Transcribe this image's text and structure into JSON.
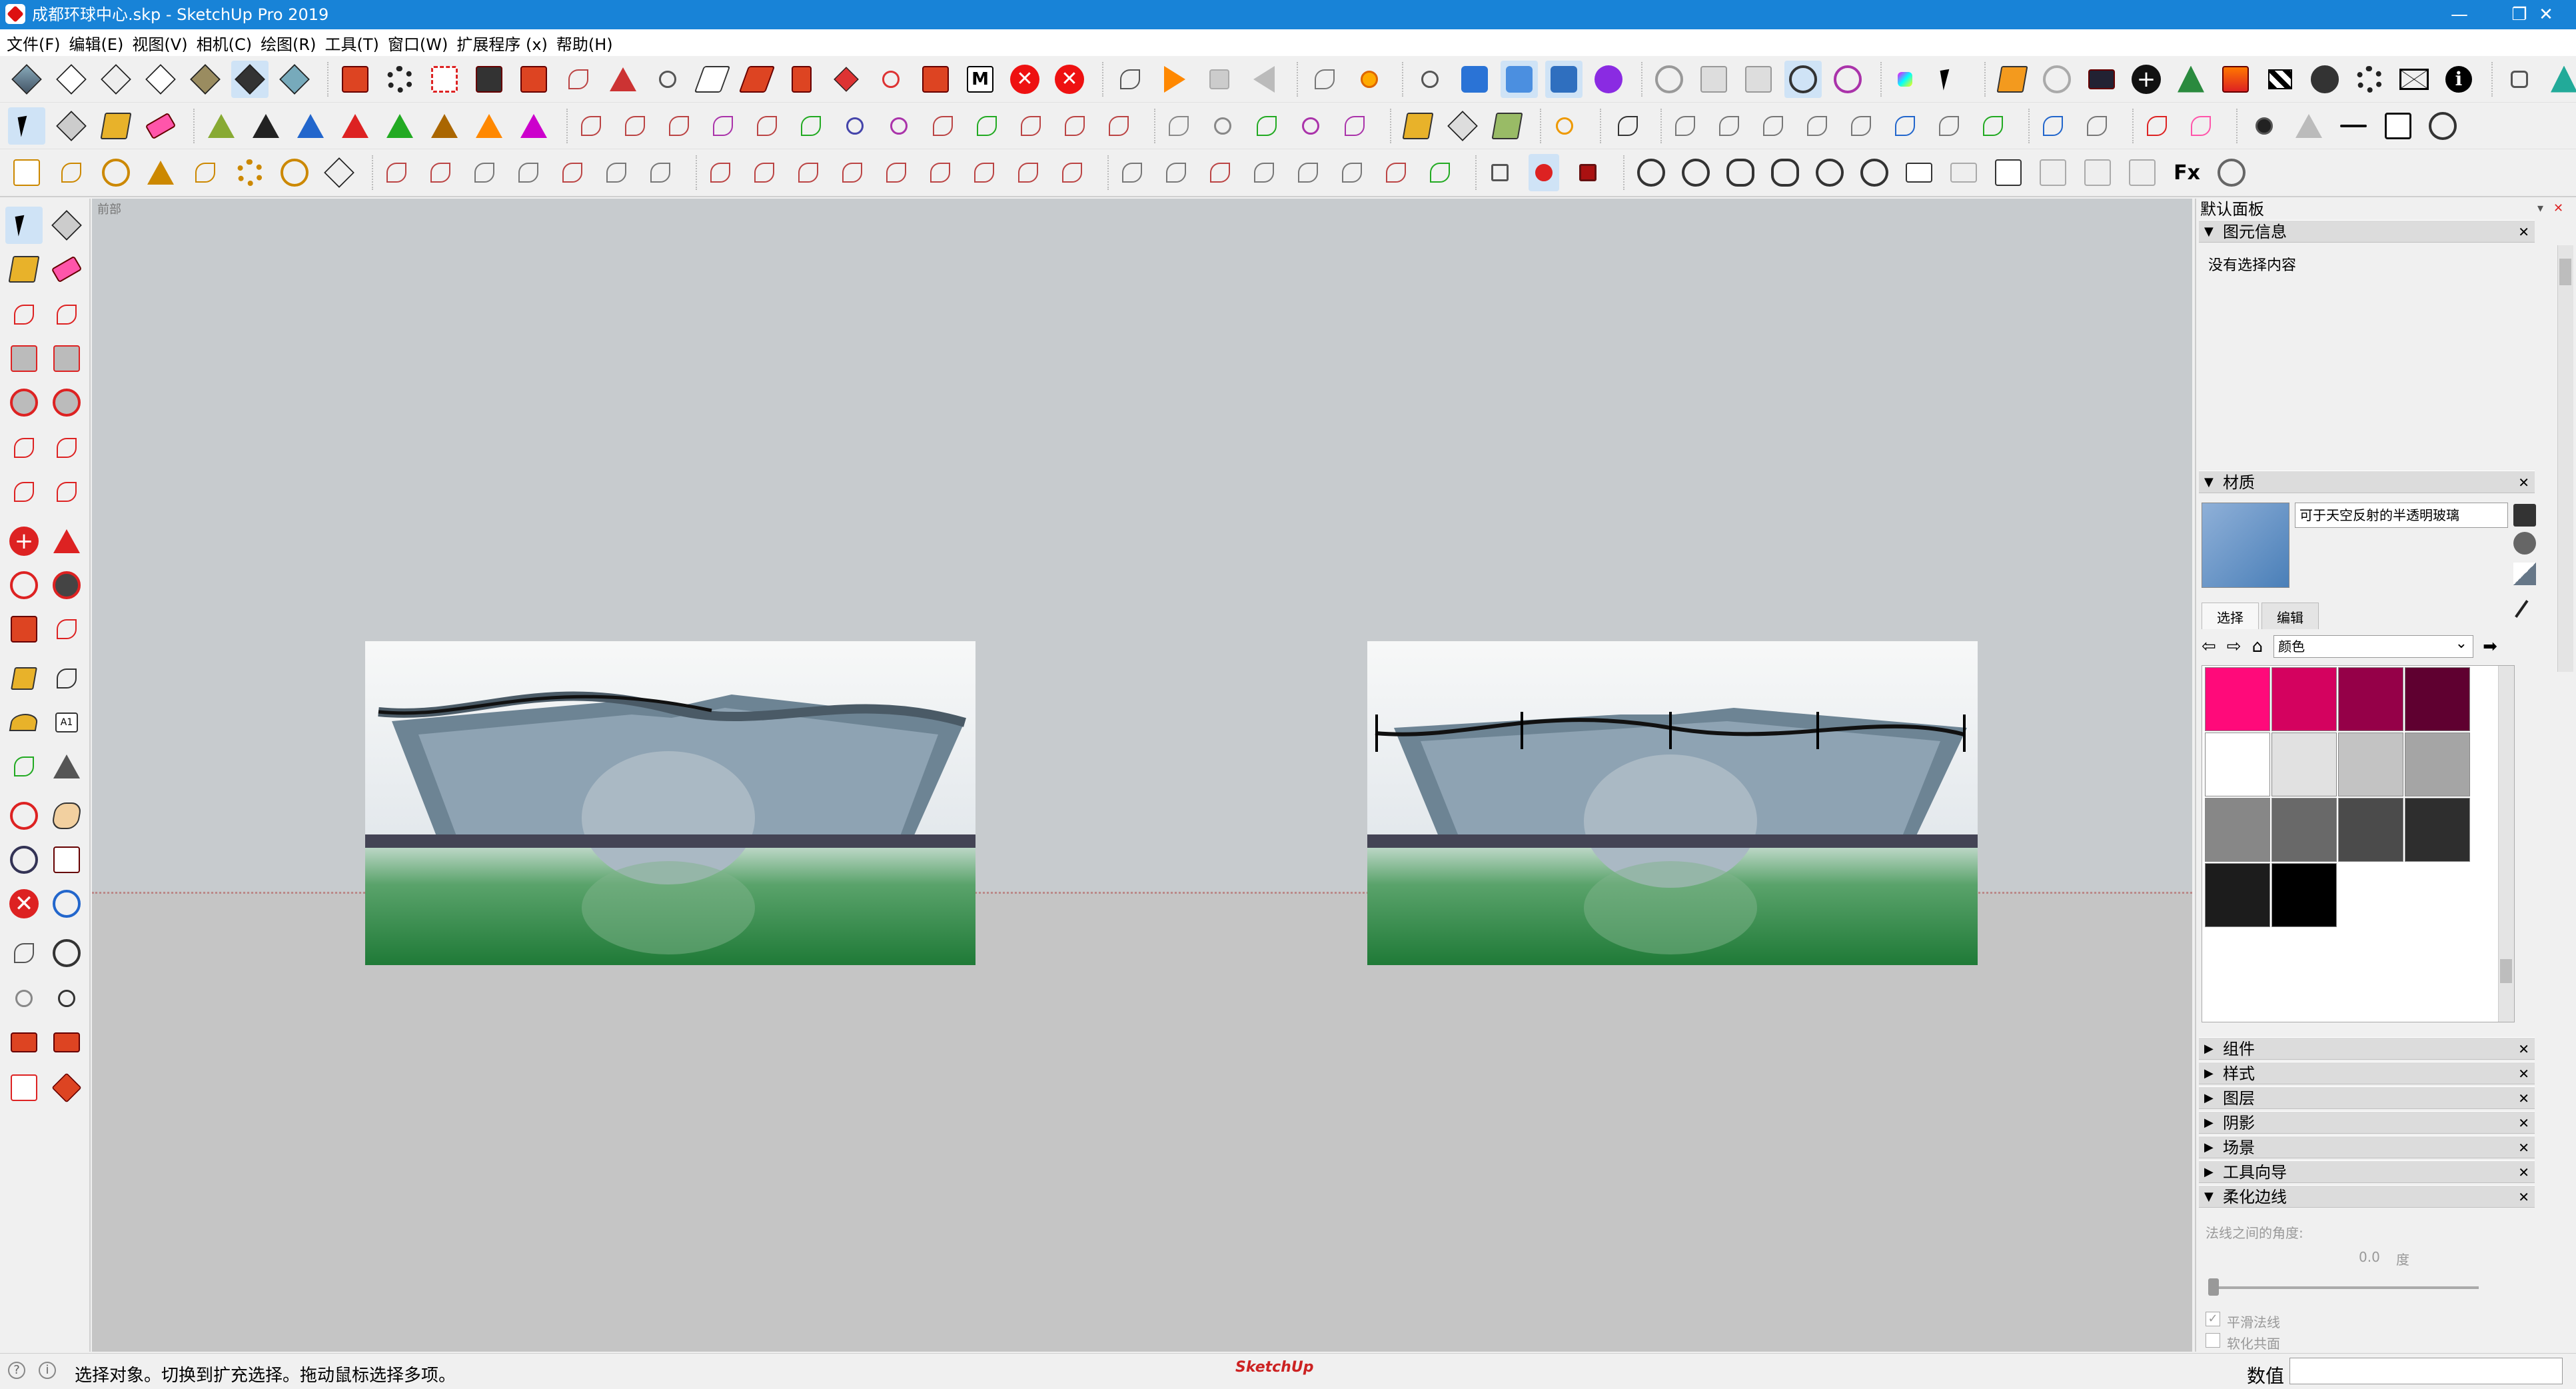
{
  "window": {
    "title": "成都环球中心.skp - SketchUp Pro 2019",
    "controls": {
      "minimize": "—",
      "restore": "❐",
      "close": "✕"
    }
  },
  "menu": [
    "文件(F)",
    "编辑(E)",
    "视图(V)",
    "相机(C)",
    "绘图(R)",
    "工具(T)",
    "窗口(W)",
    "扩展程序 (x)",
    "帮助(H)"
  ],
  "viewport": {
    "label": "前部"
  },
  "tray": {
    "title": "默认面板",
    "entity_info": {
      "header": "图元信息",
      "text": "没有选择内容"
    },
    "materials": {
      "header": "材质",
      "current_name": "可于天空反射的半透明玻璃",
      "tabs": [
        "选择",
        "编辑"
      ],
      "library": "颜色",
      "swatches": [
        "#ff0a7a",
        "#d4025f",
        "#950048",
        "#5f0030",
        "#ffffff",
        "#e1e1e1",
        "#c3c3c3",
        "#a5a5a5",
        "#878787",
        "#696969",
        "#4b4b4b",
        "#2e2e2e",
        "#1c1c1c",
        "#000000"
      ]
    },
    "collapsed_panels": [
      "组件",
      "样式",
      "图层",
      "阴影",
      "场景",
      "工具向导"
    ],
    "soften": {
      "header": "柔化边线",
      "angle_label": "法线之间的角度:",
      "angle_value": "0.0",
      "angle_unit": "度",
      "smooth_normals": "平滑法线",
      "soften_coplanar": "软化共面"
    }
  },
  "status": {
    "message": "选择对象。切换到扩充选择。拖动鼠标选择多项。",
    "measurements_label": "数值",
    "logo": "SketchUp"
  }
}
